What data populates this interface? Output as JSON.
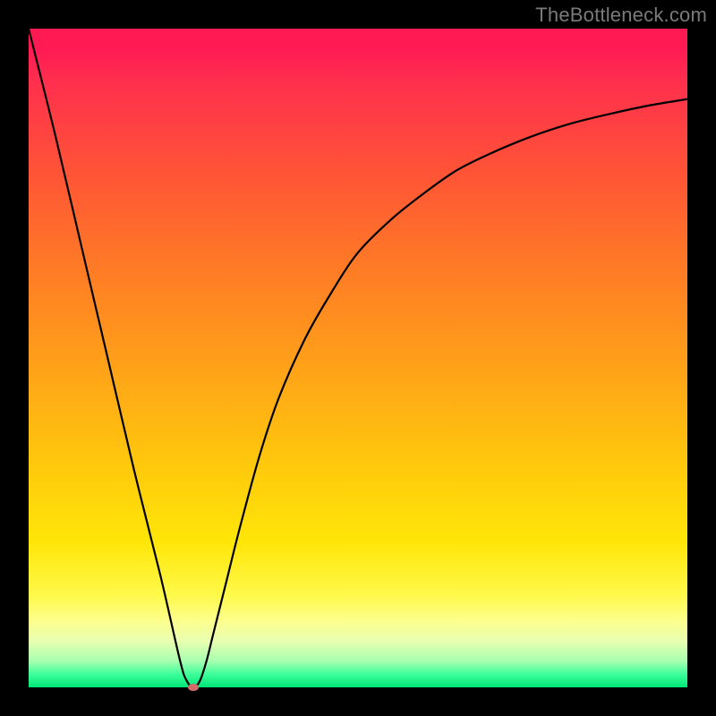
{
  "watermark": "TheBottleneck.com",
  "chart_data": {
    "type": "line",
    "title": "",
    "xlabel": "",
    "ylabel": "",
    "xlim": [
      0,
      100
    ],
    "ylim": [
      0,
      100
    ],
    "grid": false,
    "series": [
      {
        "name": "curve",
        "x": [
          0,
          4,
          8,
          12,
          16,
          20,
          23,
          24,
          25,
          26,
          27,
          28,
          30,
          32,
          35,
          38,
          42,
          46,
          50,
          55,
          60,
          65,
          70,
          76,
          82,
          88,
          94,
          100
        ],
        "values": [
          100,
          84,
          67,
          50,
          33,
          17,
          4,
          1,
          0,
          1,
          4,
          8,
          16,
          24,
          35,
          44,
          53,
          60,
          66,
          71,
          75,
          78.5,
          81,
          83.5,
          85.5,
          87,
          88.3,
          89.3
        ]
      }
    ],
    "marker": {
      "x": 25,
      "y": 0
    },
    "colors": {
      "curve": "#000000",
      "marker": "#d46a6a",
      "gradient": [
        "#ff1a54",
        "#ff5436",
        "#ffa318",
        "#ffe608",
        "#fcff8e",
        "#3dff9a",
        "#00e676"
      ]
    }
  }
}
